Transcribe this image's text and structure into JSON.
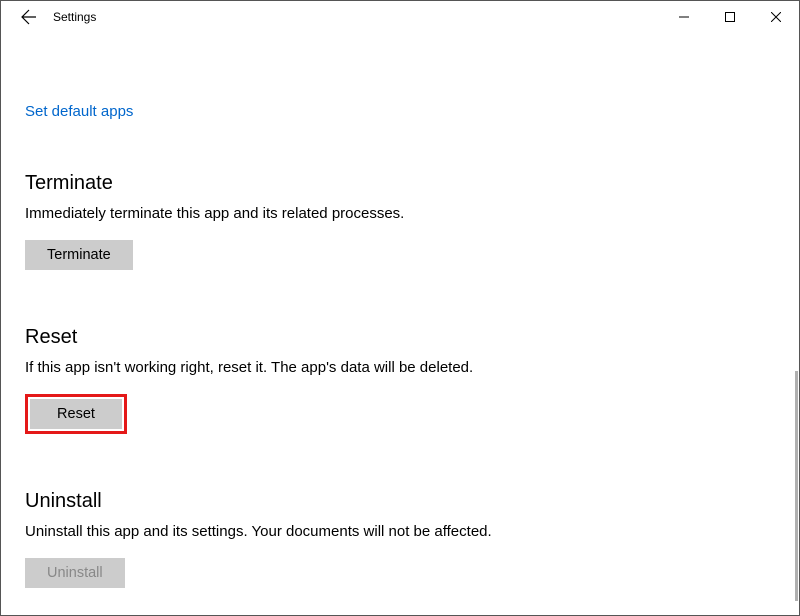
{
  "titlebar": {
    "title": "Settings"
  },
  "link": {
    "set_default_apps": "Set default apps"
  },
  "sections": {
    "terminate": {
      "heading": "Terminate",
      "description": "Immediately terminate this app and its related processes.",
      "button": "Terminate"
    },
    "reset": {
      "heading": "Reset",
      "description": "If this app isn't working right, reset it. The app's data will be deleted.",
      "button": "Reset"
    },
    "uninstall": {
      "heading": "Uninstall",
      "description": "Uninstall this app and its settings. Your documents will not be affected.",
      "button": "Uninstall"
    }
  }
}
